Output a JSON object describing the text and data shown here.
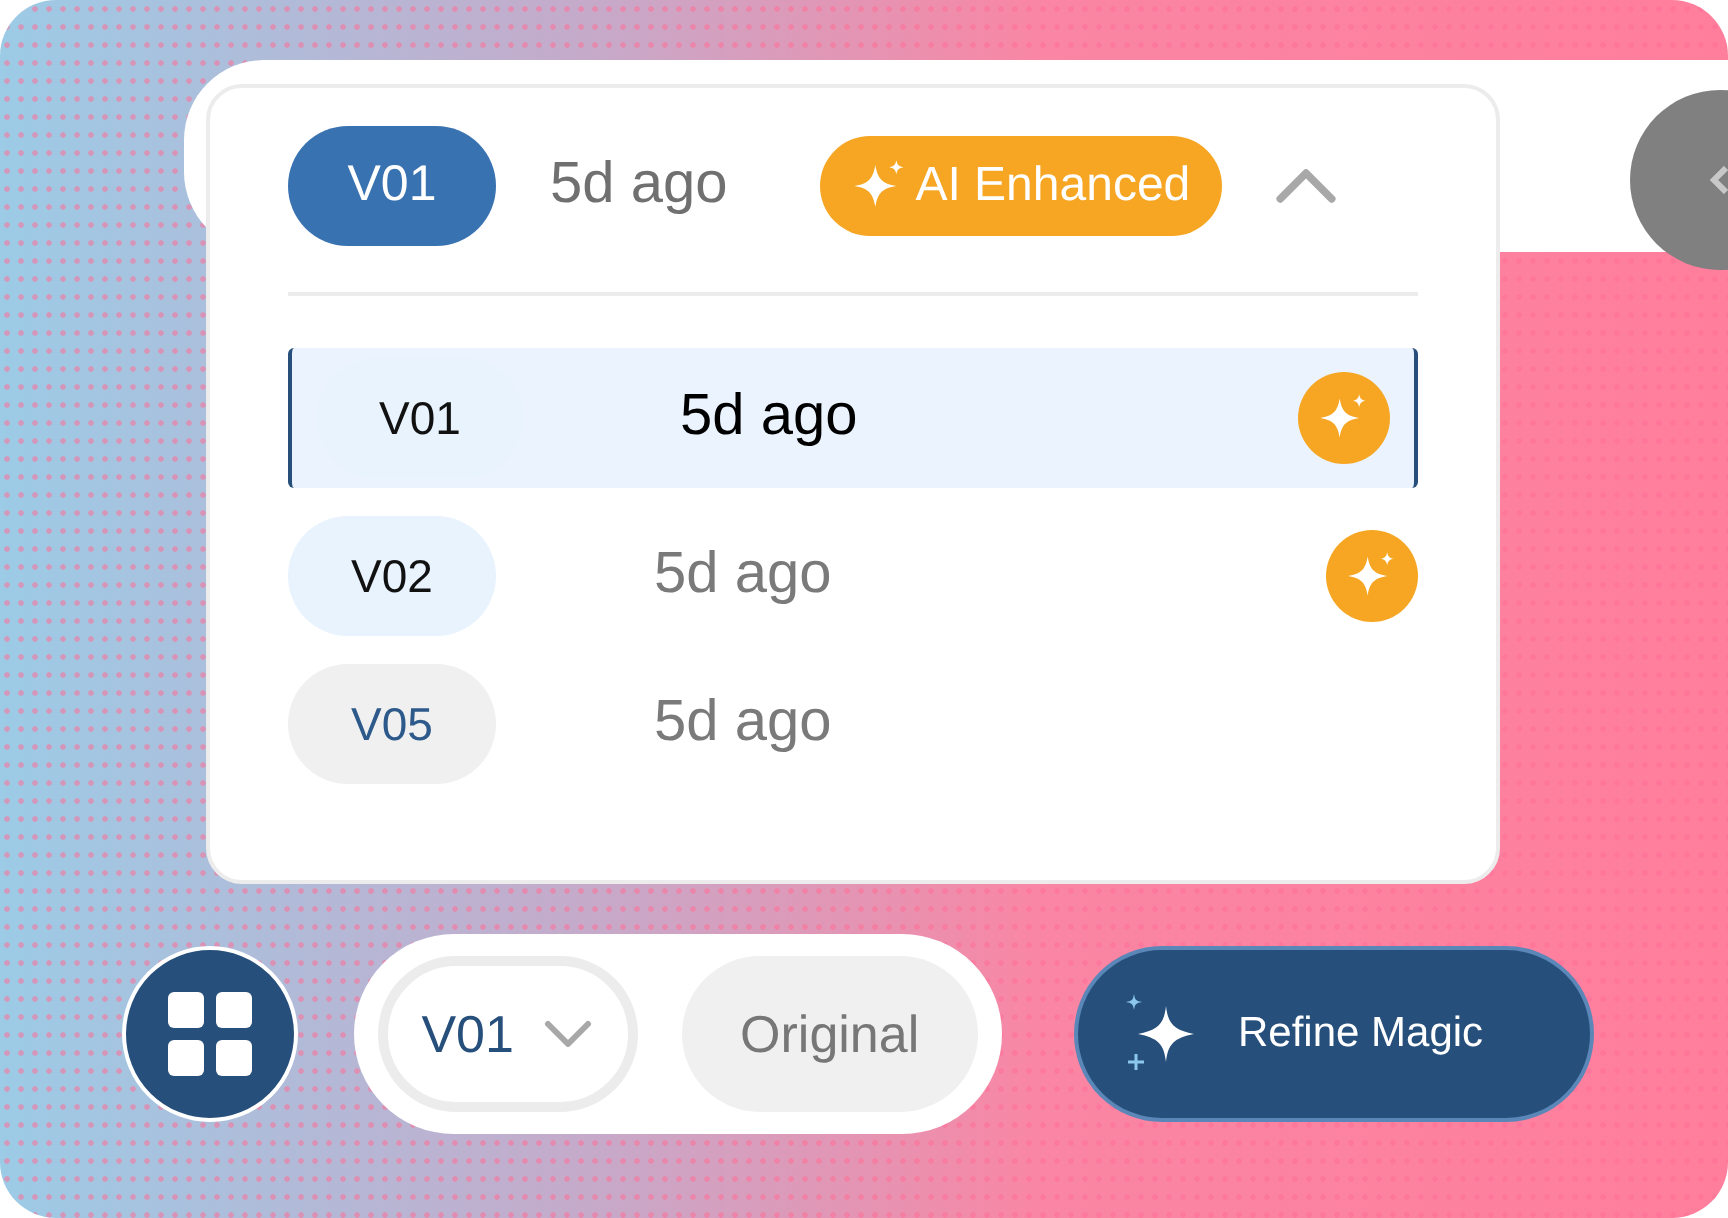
{
  "header": {
    "version": "V01",
    "time": "5d ago",
    "badge": "AI Enhanced",
    "expanded": true
  },
  "versions": [
    {
      "version": "V01",
      "time": "5d ago",
      "selected": true,
      "enhanced": true
    },
    {
      "version": "V02",
      "time": "5d ago",
      "selected": false,
      "enhanced": true
    },
    {
      "version": "V05",
      "time": "5d ago",
      "selected": false,
      "enhanced": false
    }
  ],
  "toolbar": {
    "version_select": "V01",
    "original_button": "Original",
    "refine_button": "Refine Magic"
  }
}
